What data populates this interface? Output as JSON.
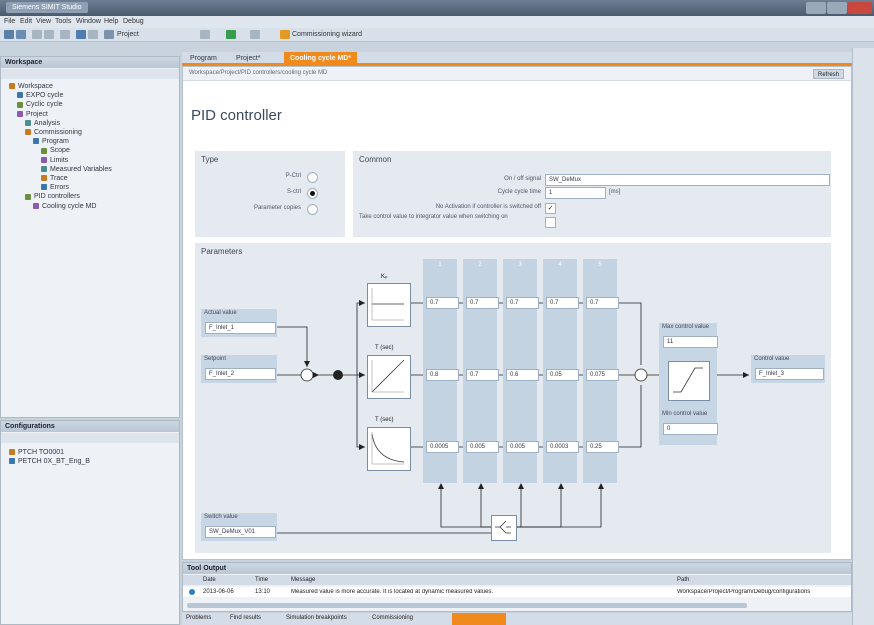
{
  "window": {
    "title": "Siemens SIMIT Studio",
    "accent": "#f08a1c"
  },
  "menubar": [
    "File",
    "Edit",
    "View",
    "Tools",
    "Window",
    "Help",
    "Debug"
  ],
  "toolbar": {
    "project_label": "Project",
    "save_label": "Commissioning wizard",
    "warn_icon": "warning-icon"
  },
  "workspace": {
    "title": "Workspace",
    "tree": [
      {
        "label": "Workspace",
        "depth": 0
      },
      {
        "label": "EXPO cycle",
        "depth": 1
      },
      {
        "label": "Cyclic cycle",
        "depth": 1
      },
      {
        "label": "Project",
        "depth": 1
      },
      {
        "label": "Analysis",
        "depth": 2
      },
      {
        "label": "Commissioning",
        "depth": 2
      },
      {
        "label": "Program",
        "depth": 3
      },
      {
        "label": "Scope",
        "depth": 4
      },
      {
        "label": "Limits",
        "depth": 4
      },
      {
        "label": "Measured Variables",
        "depth": 4
      },
      {
        "label": "Trace",
        "depth": 4
      },
      {
        "label": "Errors",
        "depth": 4
      },
      {
        "label": "PID controllers",
        "depth": 2
      },
      {
        "label": "Cooling cycle MD",
        "depth": 3
      }
    ]
  },
  "configurations": {
    "title": "Configurations",
    "tree": [
      {
        "label": "PTCH TO0001",
        "depth": 0
      },
      {
        "label": "PETCH 0X_BT_Eng_B",
        "depth": 0
      }
    ]
  },
  "tabs": [
    "Program",
    "Project*",
    "Cooling cycle MD*"
  ],
  "breadcrumb": "Workspace/Project/PID controllers/cooling cycle MD",
  "refresh_label": "Refresh",
  "page_title": "PID controller",
  "type_section": {
    "title": "Type",
    "options": [
      {
        "label": "P-Ctrl",
        "selected": false
      },
      {
        "label": "S-ctrl",
        "selected": true
      },
      {
        "label": "Parameter copies",
        "selected": false
      }
    ]
  },
  "common_section": {
    "title": "Common",
    "on_off_label": "On / off signal",
    "on_off_value": "SW_DeMux",
    "cycle_label": "Cycle cycle time",
    "cycle_value": "1",
    "cycle_unit": "[ms]",
    "deactivate_label": "No Activation if controller is switched off",
    "deactivate_checked": true,
    "takeover_label": "Take control value to integrator value when switching on",
    "takeover_checked": false
  },
  "params_section": {
    "title": "Parameters",
    "actual_label": "Actual value",
    "actual_value": "F_Inlet_1",
    "setpoint_label": "Setpoint",
    "setpoint_value": "F_Inlet_2",
    "switch_label": "Switch value",
    "switch_value": "SW_DeMux_V01",
    "kp_label": "Kₚ",
    "ti_label": "T (sec)",
    "td_label": "T (sec)",
    "columns": [
      "1",
      "2",
      "3",
      "4",
      "5"
    ],
    "row_kp": [
      "0.7",
      "0.7",
      "0.7",
      "0.7",
      "0.7"
    ],
    "row_ti": [
      "0.8",
      "0.7",
      "0.6",
      "0.05",
      "0.075"
    ],
    "row_td": [
      "0.0005",
      "0.005",
      "0.005",
      "0.0003",
      "0.25"
    ],
    "max_label": "Max control value",
    "max_value": "11",
    "min_label": "Min control value",
    "min_value": "0",
    "control_label": "Control value",
    "control_value": "F_Inlet_3"
  },
  "output": {
    "title": "Tool Output",
    "columns": [
      "Date",
      "Time",
      "Message",
      "Path"
    ],
    "row": {
      "date": "2013-06-06",
      "time": "13:10",
      "message": "Measured value is more accurate. It is located at dynamic measured values.",
      "path": "Workspace/Project/Program/Debug/configurations"
    }
  },
  "statusbar": {
    "items": [
      "Problems",
      "Find results",
      "Simulation breakpoints",
      "Commissioning"
    ]
  }
}
